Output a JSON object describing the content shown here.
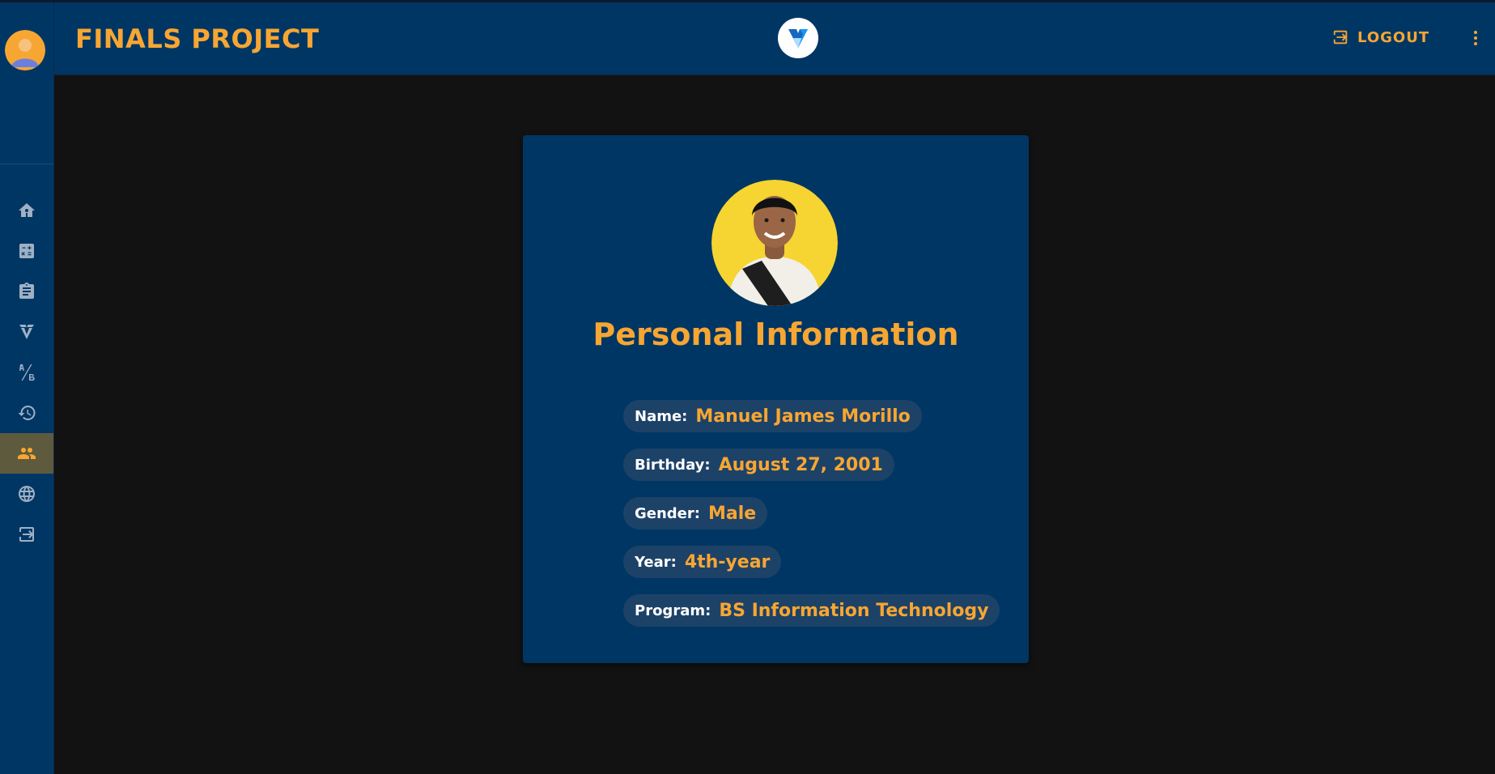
{
  "appbar": {
    "title": "FINALS PROJECT",
    "logout_label": "LOGOUT",
    "logo_icon": "vuetify-logo-icon",
    "menu_icon": "dots-vertical-icon"
  },
  "sidebar": {
    "avatar_icon": "user-avatar",
    "items": [
      {
        "icon": "home-icon",
        "active": false
      },
      {
        "icon": "calculator-icon",
        "active": false
      },
      {
        "icon": "clipboard-icon",
        "active": false
      },
      {
        "icon": "vuetify-icon",
        "active": false
      },
      {
        "icon": "ab-testing-icon",
        "active": false
      },
      {
        "icon": "history-icon",
        "active": false
      },
      {
        "icon": "account-group-icon",
        "active": true
      },
      {
        "icon": "globe-icon",
        "active": false
      },
      {
        "icon": "logout-icon",
        "active": false
      }
    ]
  },
  "card": {
    "title": "Personal Information",
    "fields": [
      {
        "label": "Name:",
        "value": "Manuel James Morillo"
      },
      {
        "label": "Birthday:",
        "value": "August 27, 2001"
      },
      {
        "label": "Gender:",
        "value": "Male"
      },
      {
        "label": "Year:",
        "value": "4th-year"
      },
      {
        "label": "Program:",
        "value": "BS Information Technology"
      }
    ]
  },
  "colors": {
    "primary": "#003664",
    "accent": "#f7a632",
    "background": "#121212",
    "chip": "#1d4268",
    "active_nav": "#5e5a3e"
  }
}
